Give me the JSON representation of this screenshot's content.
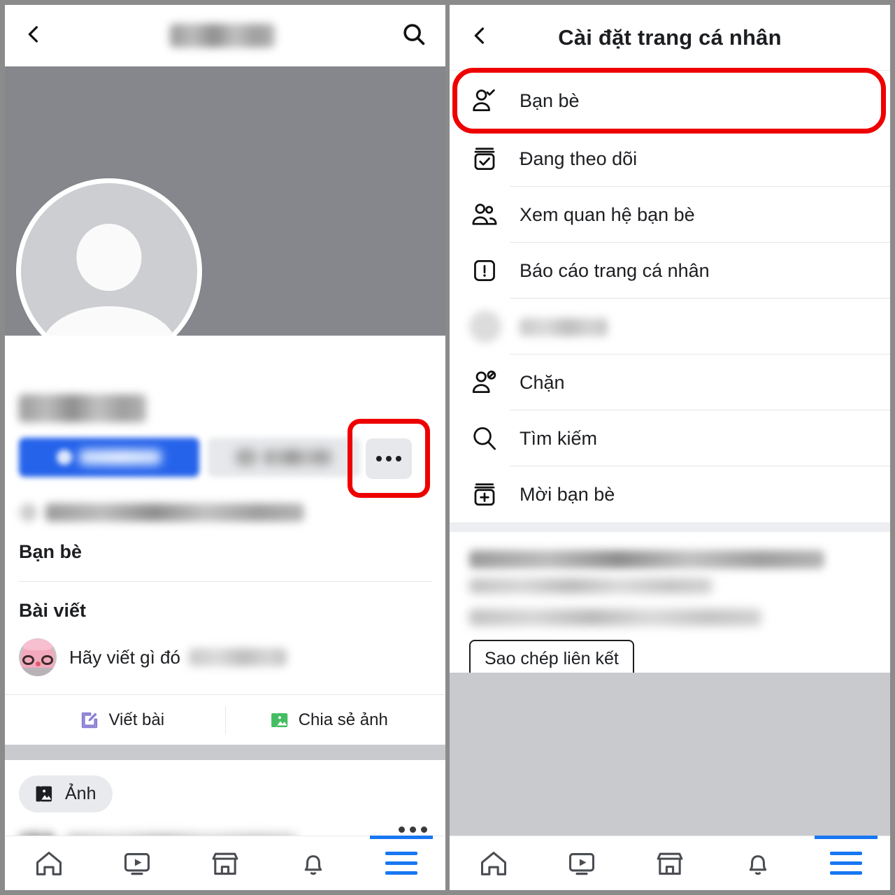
{
  "left_screen": {
    "topbar": {
      "back_icon": "chevron-left-icon",
      "title_redacted": true,
      "search_icon": "search-icon"
    },
    "profile": {
      "avatar_icon": "default-avatar-icon",
      "name_redacted": true,
      "primary_button": {
        "label_redacted": true,
        "color": "#2563eb"
      },
      "secondary_button": {
        "label_redacted": true,
        "color": "#e6e8eb"
      },
      "more_button": {
        "icon": "ellipsis-icon",
        "highlighted": true,
        "highlight_color": "#ee0000"
      },
      "meta_redacted": true
    },
    "sections": [
      {
        "title": "Bạn bè"
      },
      {
        "title": "Bài viết"
      }
    ],
    "composer": {
      "avatar_icon": "user-avatar-icon",
      "placeholder": "Hãy viết gì đó",
      "trailing_redacted": true
    },
    "actions": [
      {
        "label": "Viết bài",
        "icon": "pencil-square-icon",
        "color": "#8b7fd4"
      },
      {
        "label": "Chia sẻ ảnh",
        "icon": "photo-icon",
        "color": "#45bd62"
      }
    ],
    "chips": [
      {
        "label": "Ảnh",
        "icon": "photo-stack-icon"
      }
    ],
    "blurred_post_row": {
      "has_menu": true,
      "menu_icon": "ellipsis-icon"
    }
  },
  "right_screen": {
    "topbar": {
      "back_icon": "chevron-left-icon",
      "title": "Cài đặt trang cá nhân"
    },
    "menu_items": [
      {
        "label": "Bạn bè",
        "icon": "person-check-icon",
        "highlighted": true
      },
      {
        "label": "Đang theo dõi",
        "icon": "jar-check-icon",
        "highlighted": false
      },
      {
        "label": "Xem quan hệ bạn bè",
        "icon": "two-people-icon",
        "highlighted": false
      },
      {
        "label": "Báo cáo trang cá nhân",
        "icon": "exclamation-box-icon",
        "highlighted": false
      },
      {
        "label": "",
        "icon": "blurred-icon",
        "highlighted": false,
        "redacted": true
      },
      {
        "label": "Chặn",
        "icon": "person-block-icon",
        "highlighted": false
      },
      {
        "label": "Tìm kiếm",
        "icon": "search-icon",
        "highlighted": false
      },
      {
        "label": "Mời bạn bè",
        "icon": "jar-plus-icon",
        "highlighted": false
      }
    ],
    "info_block": {
      "lines_redacted": 3
    },
    "copy_button": {
      "label": "Sao chép liên kết"
    }
  },
  "bottom_nav": {
    "items": [
      {
        "icon": "home-icon",
        "active": false
      },
      {
        "icon": "video-icon",
        "active": false
      },
      {
        "icon": "marketplace-icon",
        "active": false
      },
      {
        "icon": "bell-icon",
        "active": false
      },
      {
        "icon": "menu-icon",
        "active": true
      }
    ],
    "active_color": "#1877f2"
  },
  "annotations": {
    "highlight_color": "#ee0000",
    "highlight_shapes": [
      "rounded-rect-around-ban-be",
      "rounded-rect-around-more-button"
    ]
  }
}
